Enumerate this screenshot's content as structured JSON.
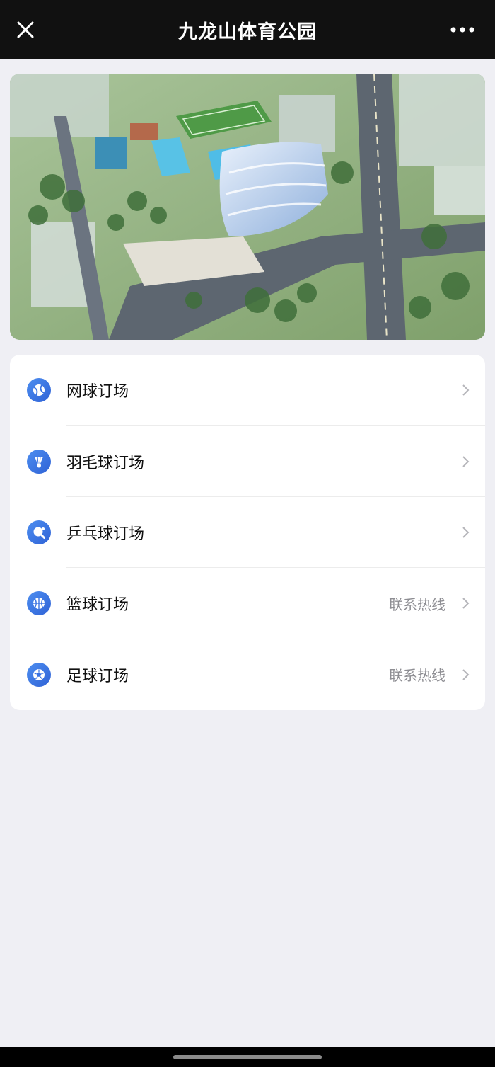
{
  "header": {
    "title": "九龙山体育公园",
    "close_icon": "close-icon",
    "more_icon": "more-dots-icon"
  },
  "banner": {
    "icon": "aerial-rendering-image"
  },
  "menu": {
    "items": [
      {
        "label": "网球订场",
        "extra": "",
        "icon": "tennis-ball-icon"
      },
      {
        "label": "羽毛球订场",
        "extra": "",
        "icon": "shuttlecock-icon"
      },
      {
        "label": "乒乓球订场",
        "extra": "",
        "icon": "ping-pong-icon"
      },
      {
        "label": "篮球订场",
        "extra": "联系热线",
        "icon": "basketball-icon"
      },
      {
        "label": "足球订场",
        "extra": "联系热线",
        "icon": "soccer-ball-icon"
      }
    ]
  },
  "colors": {
    "accent": "#3a73e3",
    "header_bg": "#111111",
    "page_bg": "#efeff4"
  }
}
